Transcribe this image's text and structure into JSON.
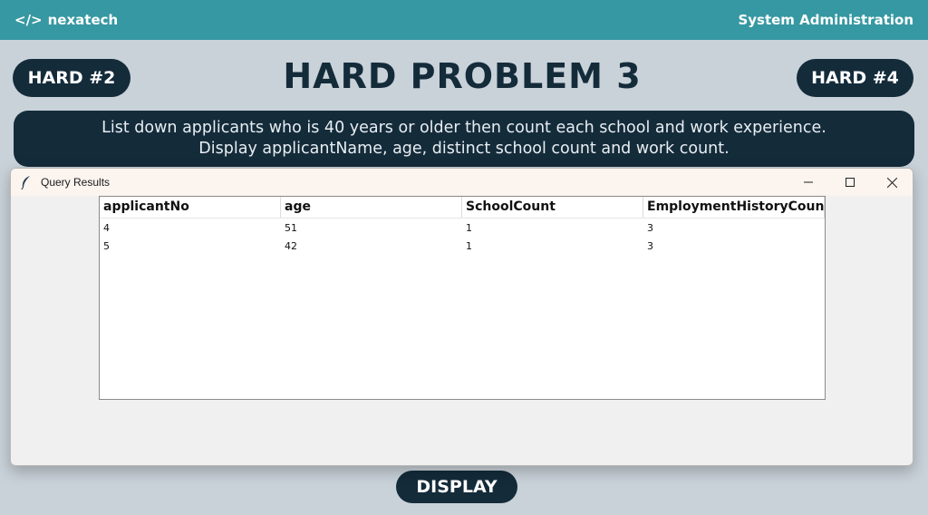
{
  "header": {
    "brand_icon": "</>",
    "brand_name": "nexatech",
    "right_text": "System Administration"
  },
  "nav": {
    "prev_label": "HARD #2",
    "next_label": "HARD #4"
  },
  "page": {
    "title": "HARD PROBLEM 3",
    "description_line1": "List down applicants who is 40 years or older then count each school and work experience.",
    "description_line2": "Display applicantName, age, distinct school count and work count.",
    "display_label": "DISPLAY"
  },
  "window": {
    "title": "Query Results",
    "icon": "feather-icon"
  },
  "results": {
    "columns": [
      "applicantNo",
      "age",
      "SchoolCount",
      "EmploymentHistoryCount"
    ],
    "rows": [
      [
        "4",
        "51",
        "1",
        "3"
      ],
      [
        "5",
        "42",
        "1",
        "3"
      ]
    ]
  },
  "colors": {
    "topbar": "#3698a2",
    "navy": "#142b3a",
    "background": "#c9d2d9"
  }
}
